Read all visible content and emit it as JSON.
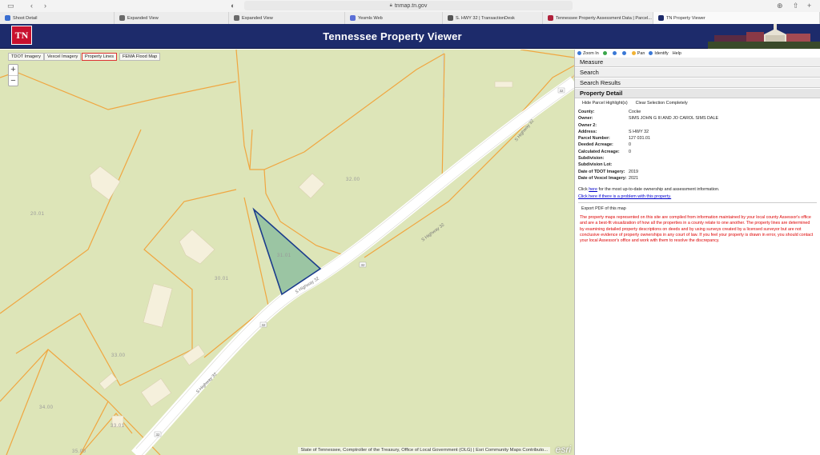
{
  "browser": {
    "url": "tnmap.tn.gov",
    "tabs": [
      {
        "title": "Shoot Detail",
        "icon": "tab-page-icon",
        "color": "#3b6fd1"
      },
      {
        "title": "Expanded View",
        "icon": "tab-page-icon",
        "color": "#6a6a6a"
      },
      {
        "title": "Expanded View",
        "icon": "tab-page-icon",
        "color": "#6a6a6a"
      },
      {
        "title": "Yesmls Web",
        "icon": "tab-globe-icon",
        "color": "#5b6fd6"
      },
      {
        "title": "S. HWY 32 | TransactionDesk",
        "icon": "tab-td-icon",
        "color": "#555"
      },
      {
        "title": "Tennessee Property Assessment Data | Parcel...",
        "icon": "tab-tn-icon",
        "color": "#b0213b"
      },
      {
        "title": "TN Property Viewer",
        "icon": "tab-tn-icon",
        "color": "#1d2b6b"
      }
    ]
  },
  "header": {
    "logo": "TN",
    "title": "Tennessee Property Viewer"
  },
  "map": {
    "layers": [
      "TDOT Imagery",
      "Vexcel Imagery",
      "Property Lines",
      "FEMA Flood Map"
    ],
    "active_layer": "Property Lines",
    "zoom_in": "+",
    "zoom_out": "−",
    "parcel_labels": [
      "20.01",
      "32.00",
      "31.01",
      "30.01",
      "33.00",
      "34.00",
      "33.01",
      "35.00"
    ],
    "road_labels": [
      "S Highway 32",
      "S Highway 32",
      "S Highway 32"
    ],
    "route_shields": [
      "32",
      "32",
      "32",
      "32"
    ],
    "attribution": "State of Tennessee, Comptroller of the Treasury, Office of Local Government (OLG) | Esri Community Maps Contributo...",
    "esri": "esri",
    "colors": {
      "background": "#dde5b8",
      "parcel_line": "#f0a640",
      "highlight_fill": "#8fbf9f",
      "highlight_stroke": "#1b3c8c",
      "road": "#ffffff"
    }
  },
  "tools": [
    "Zoom In",
    "Pan",
    "Identify",
    "Help"
  ],
  "panel": {
    "sections": [
      "Measure",
      "Search",
      "Search Results",
      "Property Detail"
    ],
    "hide_highlight": "Hide Parcel Highlight(s)",
    "clear_selection": "Clear Selection Completely",
    "rows": [
      {
        "k": "County:",
        "v": "Cocke"
      },
      {
        "k": "Owner:",
        "v": "SIMS JOHN G III AND JO CAROL SIMS DALE"
      },
      {
        "k": "Owner 2:",
        "v": ""
      },
      {
        "k": "Address:",
        "v": "S HWY 32"
      },
      {
        "k": "Parcel Number:",
        "v": "127 031.01"
      },
      {
        "k": "Deeded Acreage:",
        "v": "0"
      },
      {
        "k": "Calculated Acreage:",
        "v": "0"
      },
      {
        "k": "Subdivision:",
        "v": ""
      },
      {
        "k": "Subdivision Lot:",
        "v": ""
      },
      {
        "k": "Date of TDOT Imagery:",
        "v": "2019"
      },
      {
        "k": "Date of Vexcel Imagery:",
        "v": "2021"
      }
    ],
    "note_prefix": "Click ",
    "note_link": "here",
    "note_suffix": " for the most up-to-date ownership and assessment information.",
    "problem_link": "Click here if there is a problem with this property.",
    "export": "Export PDF of this map",
    "disclaimer": "The property maps represented on this site are compiled from information maintained by your local county Assessor's office and are a best-fit visualization of how all the properties in a county relate to one another. The property lines are determined by examining detailed property descriptions on deeds and by using surveys created by a licensed surveyor but are not conclusive evidence of property ownerships in any court of law. If you feel your property is drawn in error, you should contact your local Assessor's office and work with them to resolve the discrepancy."
  }
}
